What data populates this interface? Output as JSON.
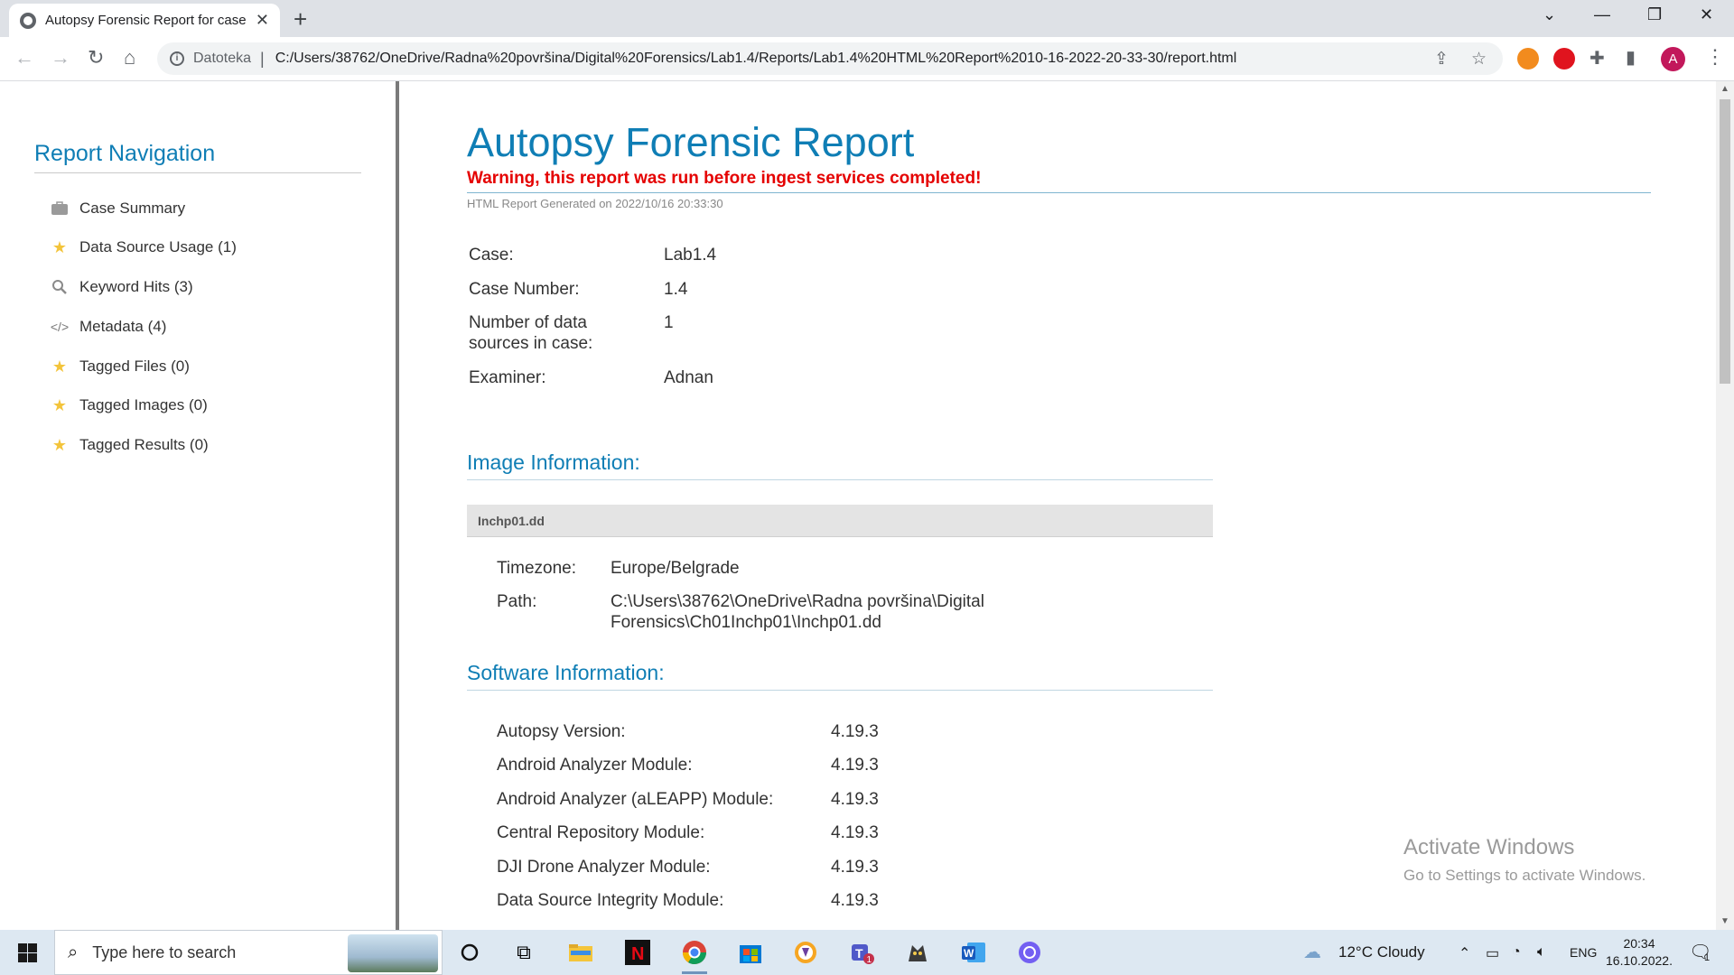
{
  "browser": {
    "tab_title": "Autopsy Forensic Report for case",
    "new_tab": "+",
    "omnibox_scheme": "Datoteka",
    "url": "C:/Users/38762/OneDrive/Radna%20površina/Digital%20Forensics/Lab1.4/Reports/Lab1.4%20HTML%20Report%2010-16-2022-20-33-30/report.html",
    "avatar_letter": "A"
  },
  "nav": {
    "title": "Report Navigation",
    "items": [
      {
        "label": "Case Summary",
        "icon": "briefcase-icon"
      },
      {
        "label": "Data Source Usage (1)",
        "icon": "star-icon"
      },
      {
        "label": "Keyword Hits (3)",
        "icon": "magnifier-icon"
      },
      {
        "label": "Metadata (4)",
        "icon": "code-icon"
      },
      {
        "label": "Tagged Files (0)",
        "icon": "star-icon"
      },
      {
        "label": "Tagged Images (0)",
        "icon": "star-icon"
      },
      {
        "label": "Tagged Results (0)",
        "icon": "star-icon"
      }
    ]
  },
  "report": {
    "title": "Autopsy Forensic Report",
    "warning": "Warning, this report was run before ingest services completed!",
    "generated": "HTML Report Generated on 2022/10/16 20:33:30",
    "case": [
      {
        "label": "Case:",
        "value": "Lab1.4"
      },
      {
        "label": "Case Number:",
        "value": "1.4"
      },
      {
        "label": "Number of data sources in case:",
        "value": "1"
      },
      {
        "label": "Examiner:",
        "value": "Adnan"
      }
    ],
    "image_section": "Image Information:",
    "image_name": "Inchp01.dd",
    "image_info": [
      {
        "label": "Timezone:",
        "value": "Europe/Belgrade"
      },
      {
        "label": "Path:",
        "value": "C:\\Users\\38762\\OneDrive\\Radna površina\\Digital Forensics\\Ch01Inchp01\\Inchp01.dd"
      }
    ],
    "software_section": "Software Information:",
    "software": [
      {
        "label": "Autopsy Version:",
        "value": "4.19.3"
      },
      {
        "label": "Android Analyzer Module:",
        "value": "4.19.3"
      },
      {
        "label": "Android Analyzer (aLEAPP) Module:",
        "value": "4.19.3"
      },
      {
        "label": "Central Repository Module:",
        "value": "4.19.3"
      },
      {
        "label": "DJI Drone Analyzer Module:",
        "value": "4.19.3"
      },
      {
        "label": "Data Source Integrity Module:",
        "value": "4.19.3"
      }
    ]
  },
  "watermark": {
    "line1": "Activate Windows",
    "line2": "Go to Settings to activate Windows."
  },
  "taskbar": {
    "search_placeholder": "Type here to search",
    "weather": "12°C  Cloudy",
    "lang": "ENG",
    "time": "20:34",
    "date": "16.10.2022.",
    "notif_count": "1"
  }
}
